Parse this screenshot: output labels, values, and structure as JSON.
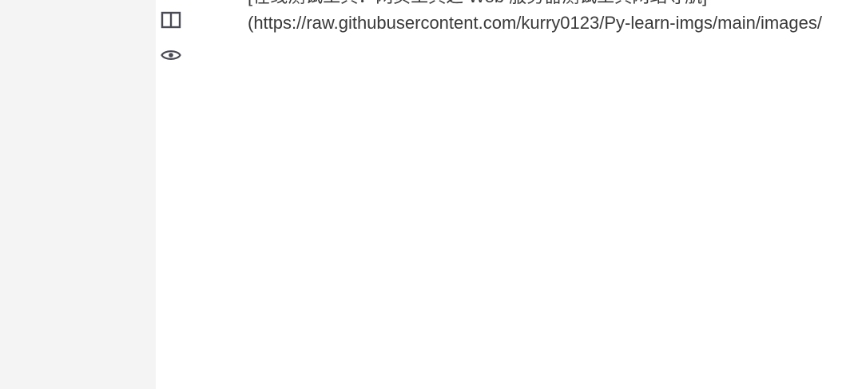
{
  "editor": {
    "toolbar": {
      "split_view_icon": "split-view-icon",
      "preview_icon": "eye-icon"
    },
    "lines": [
      "[在线测试工具：网页工具之 Web 服务器测试工具网站导航]",
      "(https://raw.githubusercontent.com/kurry0123/Py-learn-imgs/main/images/"
    ]
  },
  "colors": {
    "sidebar_bg": "#f4f4f4",
    "editor_bg": "#ffffff",
    "text": "#3a3a3a",
    "icon": "#4a4a55"
  }
}
